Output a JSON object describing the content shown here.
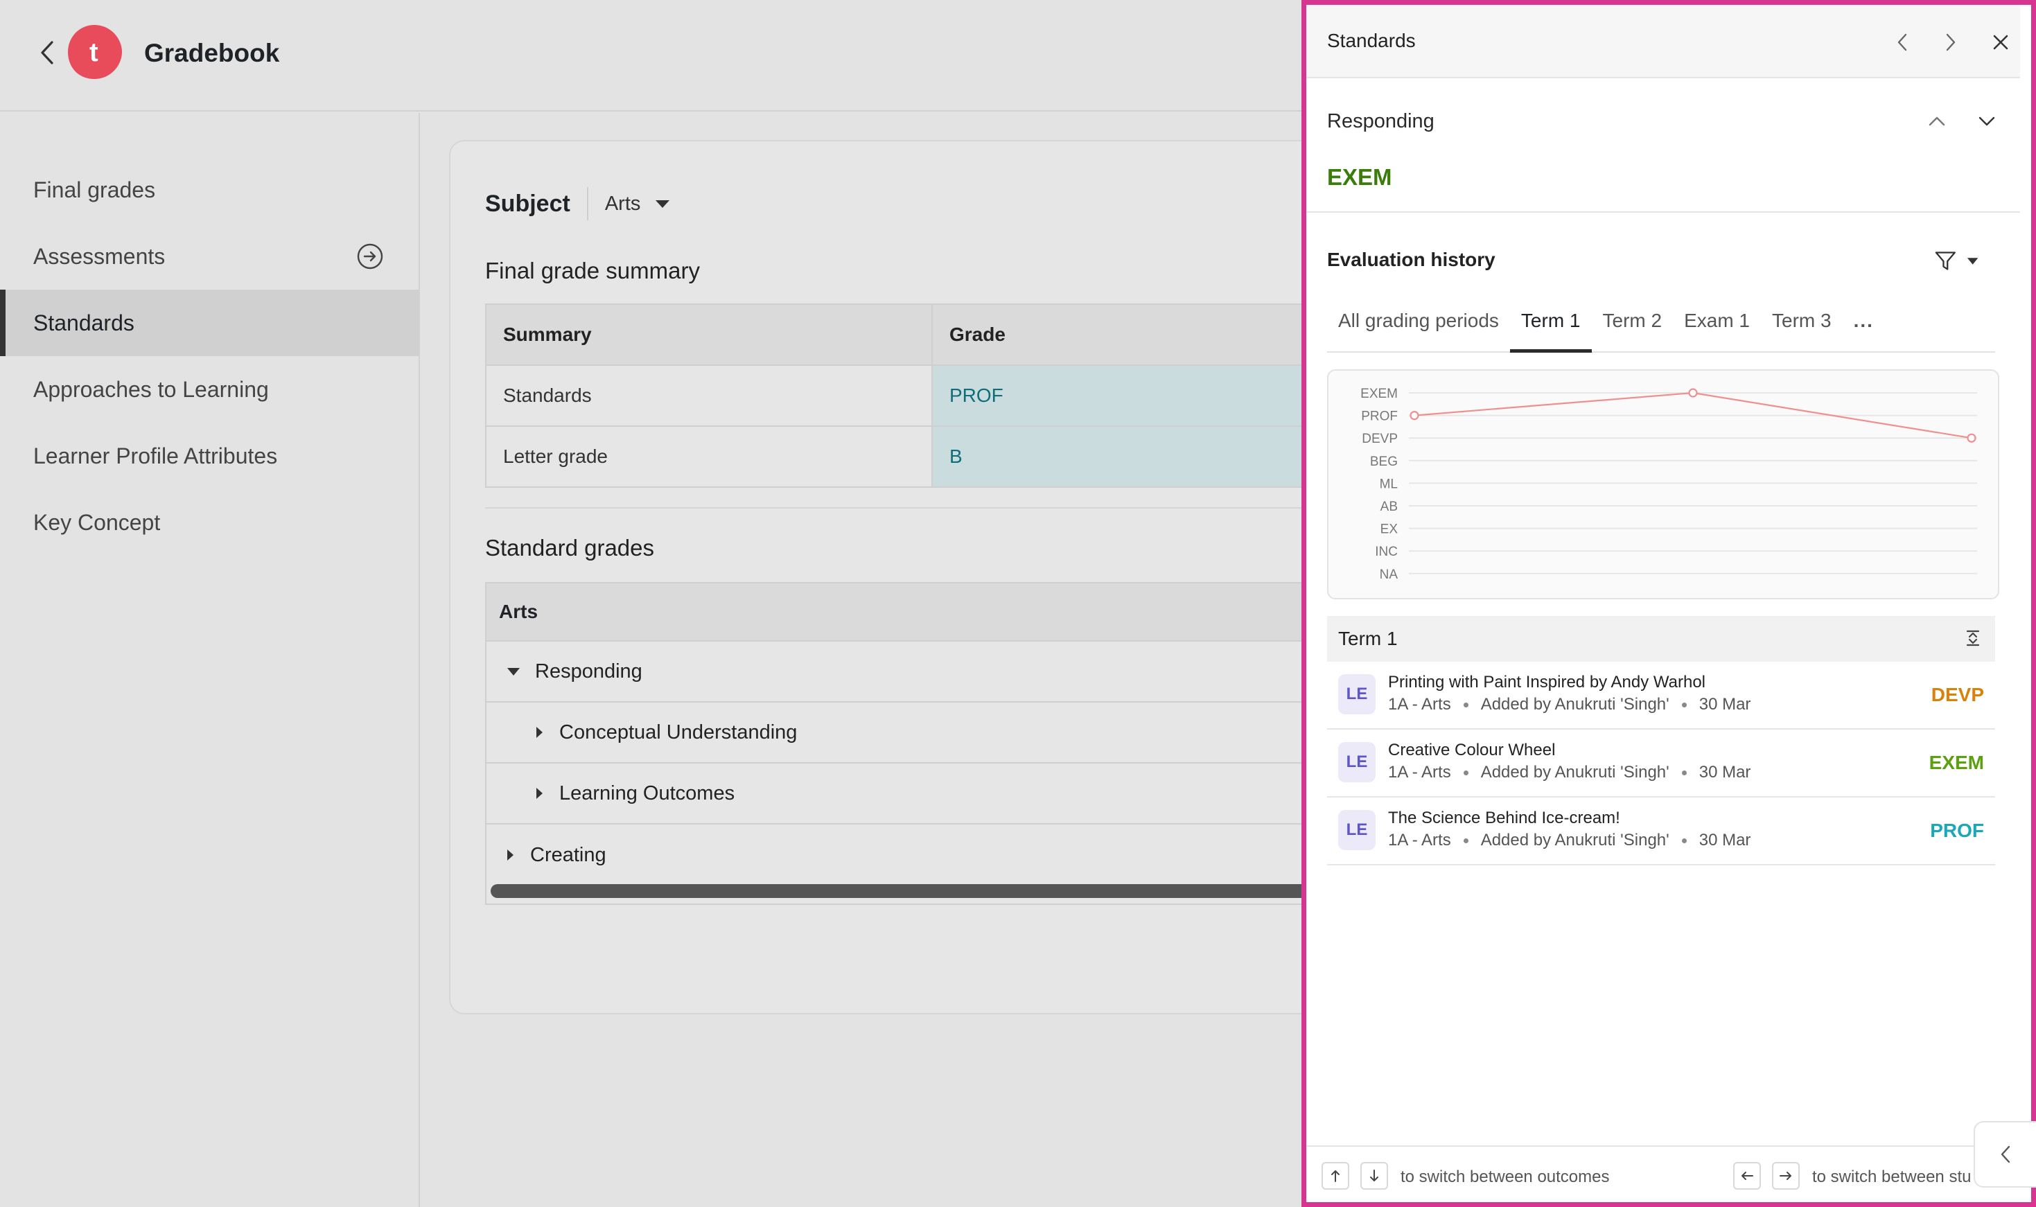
{
  "app": {
    "title": "Gradebook",
    "logo_letter": "t",
    "brand_color": "#e84c5b"
  },
  "sidebar": {
    "items": [
      {
        "label": "Final grades"
      },
      {
        "label": "Assessments",
        "icon": "arrow-right-circle-icon"
      },
      {
        "label": "Standards",
        "active": true
      },
      {
        "label": "Approaches to Learning"
      },
      {
        "label": "Learner Profile Attributes"
      },
      {
        "label": "Key Concept"
      }
    ]
  },
  "main": {
    "subject_label": "Subject",
    "subject_value": "Arts",
    "summary_title": "Final grade summary",
    "summary_table": {
      "headers": [
        "Summary",
        "Grade"
      ],
      "rows": [
        {
          "summary": "Standards",
          "grade": "PROF"
        },
        {
          "summary": "Letter grade",
          "grade": "B"
        }
      ]
    },
    "standard_grades_title": "Standard grades",
    "standards_head": "Arts",
    "standards_rows": [
      {
        "label": "Responding",
        "expanded": true
      },
      {
        "label": "Conceptual Understanding"
      },
      {
        "label": "Learning Outcomes"
      },
      {
        "label": "Creating"
      }
    ]
  },
  "panel": {
    "title": "Standards",
    "standard_name": "Responding",
    "standard_grade": "EXEM",
    "evaluation_title": "Evaluation history",
    "tabs": [
      {
        "label": "All grading periods"
      },
      {
        "label": "Term 1",
        "active": true
      },
      {
        "label": "Term 2"
      },
      {
        "label": "Exam 1"
      },
      {
        "label": "Term 3"
      },
      {
        "label": "..."
      }
    ],
    "term_header": "Term 1",
    "items": [
      {
        "badge": "LE",
        "title": "Printing with Paint Inspired by Andy Warhol",
        "class_name": "1A - Arts",
        "added_by": "Added by Anukruti 'Singh'",
        "date": "30 Mar",
        "grade": "DEVP",
        "grade_color": "#d9820b"
      },
      {
        "badge": "LE",
        "title": "Creative Colour Wheel",
        "class_name": "1A - Arts",
        "added_by": "Added by Anukruti 'Singh'",
        "date": "30 Mar",
        "grade": "EXEM",
        "grade_color": "#5ba10f"
      },
      {
        "badge": "LE",
        "title": "The Science Behind Ice-cream!",
        "class_name": "1A - Arts",
        "added_by": "Added by Anukruti 'Singh'",
        "date": "30 Mar",
        "grade": "PROF",
        "grade_color": "#1aa7b7"
      }
    ],
    "footer": {
      "outcomes_text": "to switch between outcomes",
      "students_text": "to switch between stu"
    },
    "border_color": "#d6368f"
  },
  "chart_data": {
    "type": "line",
    "y_categories": [
      "EXEM",
      "PROF",
      "DEVP",
      "BEG",
      "ML",
      "AB",
      "EX",
      "INC",
      "NA"
    ],
    "series": [
      {
        "values": [
          "PROF",
          "EXEM",
          "DEVP"
        ],
        "color": "#f08f8f"
      }
    ],
    "grid": true
  }
}
